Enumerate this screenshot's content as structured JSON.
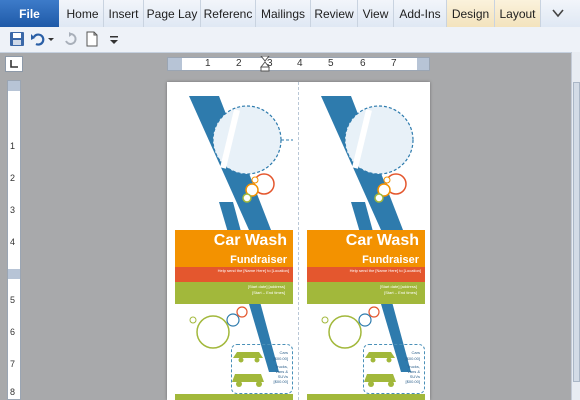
{
  "ribbon": {
    "file_label": "File",
    "tabs": [
      {
        "label": "Home"
      },
      {
        "label": "Insert"
      },
      {
        "label": "Page Lay"
      },
      {
        "label": "Referenc"
      },
      {
        "label": "Mailings"
      },
      {
        "label": "Review"
      },
      {
        "label": "View"
      },
      {
        "label": "Add-Ins"
      },
      {
        "label": "Design"
      },
      {
        "label": "Layout"
      }
    ],
    "collapse_icon": "chevron-down-icon"
  },
  "qat": {
    "icons": [
      "save-icon",
      "undo-icon",
      "redo-icon",
      "new-document-icon",
      "customize-qat-icon"
    ]
  },
  "ruler": {
    "h_numbers": [
      "1",
      "2",
      "3",
      "4",
      "5",
      "6",
      "7"
    ],
    "v_numbers": [
      "1",
      "2",
      "3",
      "4",
      "5",
      "6",
      "7",
      "8"
    ]
  },
  "flyer": {
    "title_line1": "Car Wash",
    "title_line2": "Fundraiser",
    "red_text": "Help send the [Name Here] to [Location]",
    "green_text": "[Start date] [address] [Start – End times]",
    "info_label_1": "Cars",
    "info_value_1": "[$00.00]",
    "info_label_2": "Trucks, Vans & SUVs",
    "info_value_2": "[$00.00]"
  },
  "colors": {
    "orange": "#f39200",
    "red": "#e4572e",
    "green": "#a2b83b",
    "blue": "#2e7bad",
    "file_tab": "#2a63b0"
  }
}
